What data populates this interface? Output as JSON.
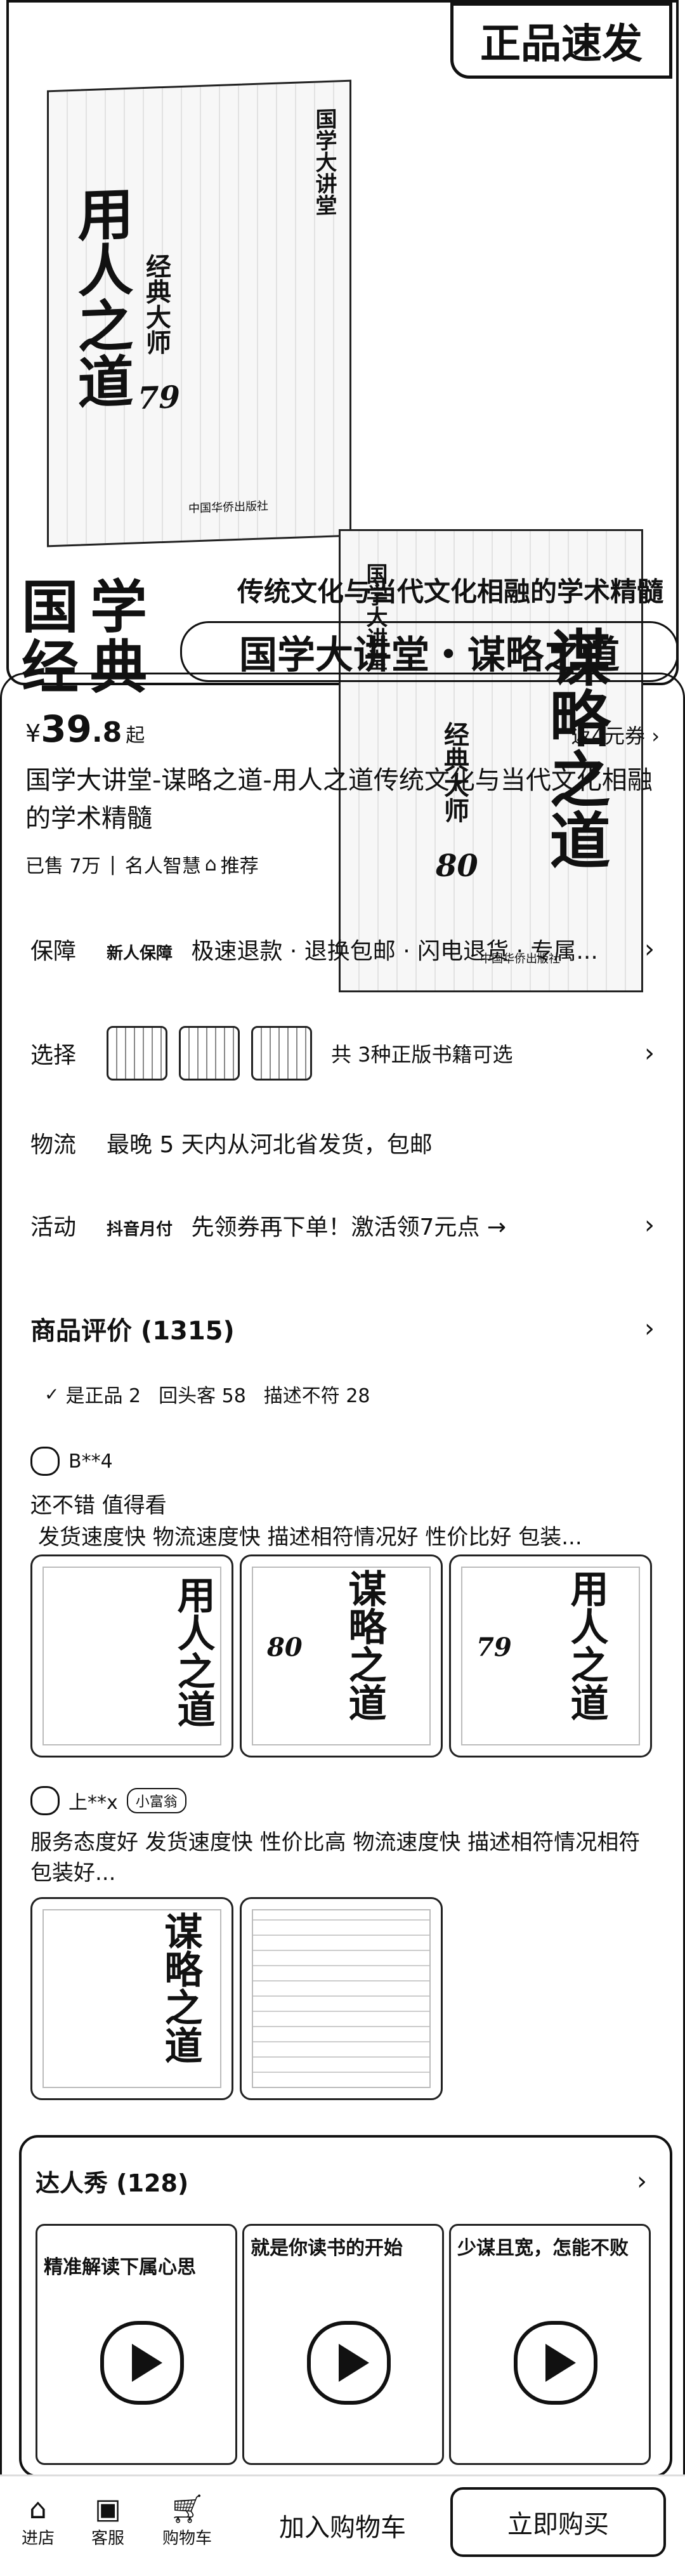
{
  "banner": {
    "top_badge": "正品速发",
    "book_left": {
      "series": "国学大讲堂",
      "title": "用人之道",
      "sub": "经典大师",
      "num": "79",
      "publisher": "中国华侨出版社"
    },
    "book_right": {
      "series": "国学大讲堂",
      "title": "谋略之道",
      "sub": "经典大师",
      "num": "80",
      "publisher": "中国华侨出版社"
    },
    "label_left_1": "国学",
    "label_left_2": "经典",
    "tagline": "传统文化与当代文化相融的学术精髓",
    "big_title": "国学大讲堂・谋略之道"
  },
  "price": {
    "currency": "¥",
    "integer": "39",
    "decimal": ".8",
    "suffix": "起",
    "coupon": "返4元券"
  },
  "product": {
    "title": "国学大讲堂-谋略之道-用人之道传统文化与当代文化相融的学术精髓",
    "sold": "已售 7万",
    "shop": "名人智慧",
    "recommend": "推荐"
  },
  "info": {
    "guarantee": {
      "label": "保障",
      "badge": "新人保障",
      "text": "极速退款 · 退换包邮 · 闪电退货 · 专属..."
    },
    "select": {
      "label": "选择",
      "text": "共 3种正版书籍可选"
    },
    "logistics": {
      "label": "物流",
      "text": "最晚 5 天内从河北省发货，包邮"
    },
    "activity": {
      "label": "活动",
      "badge": "抖音月付",
      "text": "先领券再下单！激活领7元点 →"
    }
  },
  "reviews": {
    "header": "商品评价 (1315)",
    "tags": [
      "是正品 2",
      "回头客 58",
      "描述不符 28"
    ],
    "items": [
      {
        "user": "B**4",
        "text": "还不错  值得看",
        "detail": "发货速度快 物流速度快 描述相符情况好 性价比好 包装..."
      },
      {
        "user": "上**x",
        "badge": "小富翁",
        "text": "服务态度好 发货速度快 性价比高 物流速度快 描述相符情况相符 包装好..."
      }
    ]
  },
  "influencer": {
    "header": "达人秀 (128)",
    "cap1": "精准解读下属心思",
    "cap2": "就是你读书的开始",
    "cap3": "少谋且宽，怎能不败"
  },
  "bottom_bar": {
    "shop": "进店",
    "service": "客服",
    "cart": "购物车",
    "add_cart": "加入购物车",
    "buy_now": "立即购买"
  }
}
